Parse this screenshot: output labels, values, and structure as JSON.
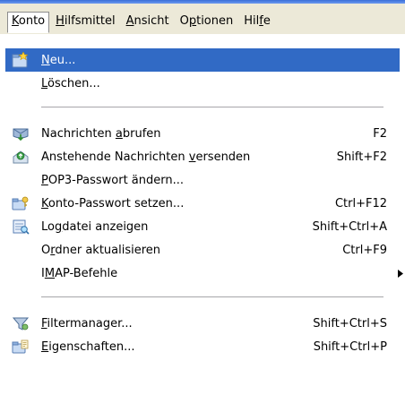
{
  "menubar": {
    "items": [
      {
        "pre": "",
        "acc": "K",
        "post": "onto"
      },
      {
        "pre": "",
        "acc": "H",
        "post": "ilfsmittel"
      },
      {
        "pre": "",
        "acc": "A",
        "post": "nsicht"
      },
      {
        "pre": "O",
        "acc": "p",
        "post": "tionen"
      },
      {
        "pre": "Hil",
        "acc": "f",
        "post": "e"
      }
    ]
  },
  "menu": {
    "items": [
      {
        "pre": "",
        "acc": "N",
        "post": "eu...",
        "shortcut": "",
        "icon": "new-account-icon"
      },
      {
        "pre": "",
        "acc": "L",
        "post": "öschen...",
        "shortcut": "",
        "icon": ""
      },
      {
        "pre": "Nachrichten ",
        "acc": "a",
        "post": "brufen",
        "shortcut": "F2",
        "icon": "get-messages-icon"
      },
      {
        "pre": "Anstehende Nachrichten ",
        "acc": "v",
        "post": "ersenden",
        "shortcut": "Shift+F2",
        "icon": "send-pending-icon"
      },
      {
        "pre": "",
        "acc": "P",
        "post": "OP3-Passwort ändern...",
        "shortcut": "",
        "icon": ""
      },
      {
        "pre": "",
        "acc": "K",
        "post": "onto-Passwort setzen...",
        "shortcut": "Ctrl+F12",
        "icon": "set-password-icon"
      },
      {
        "pre": "Lo",
        "acc": "g",
        "post": "datei anzeigen",
        "shortcut": "Shift+Ctrl+A",
        "icon": "view-log-icon"
      },
      {
        "pre": "O",
        "acc": "r",
        "post": "dner aktualisieren",
        "shortcut": "Ctrl+F9",
        "icon": ""
      },
      {
        "pre": "I",
        "acc": "M",
        "post": "AP-Befehle",
        "shortcut": "",
        "icon": ""
      },
      {
        "pre": "",
        "acc": "F",
        "post": "iltermanager...",
        "shortcut": "Shift+Ctrl+S",
        "icon": "filter-manager-icon"
      },
      {
        "pre": "",
        "acc": "E",
        "post": "igenschaften...",
        "shortcut": "Shift+Ctrl+P",
        "icon": "properties-icon"
      }
    ]
  },
  "colors": {
    "selection": "#316ac5",
    "menubar_bg": "#ece9d8",
    "separator": "#a7a6aa"
  }
}
